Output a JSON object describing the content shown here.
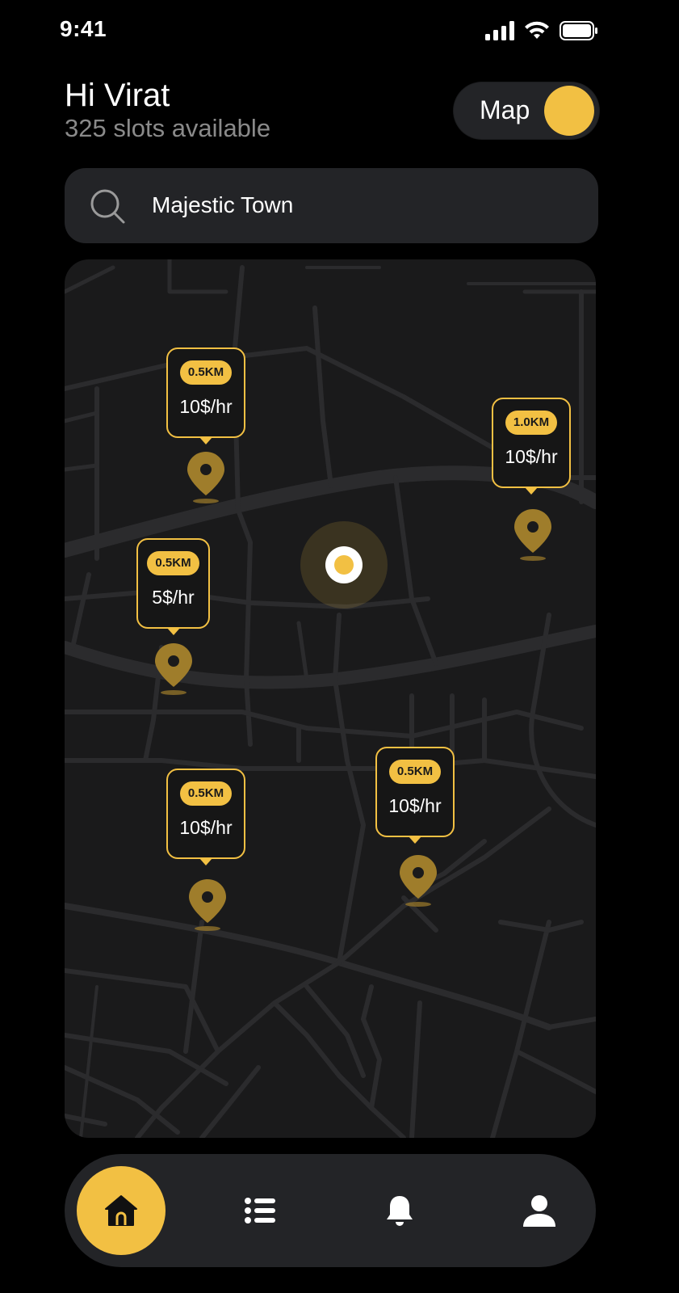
{
  "status_bar": {
    "time": "9:41"
  },
  "header": {
    "greeting": "Hi Virat",
    "subtitle": "325 slots available"
  },
  "map_toggle": {
    "label": "Map",
    "on": true
  },
  "search": {
    "value": "Majestic Town"
  },
  "colors": {
    "accent": "#f2c043",
    "surface": "#232427",
    "background": "#000000",
    "map_bg": "#1a1a1b",
    "road": "#2b2b2d"
  },
  "parking_spots": [
    {
      "distance": "0.5KM",
      "price": "10$/hr"
    },
    {
      "distance": "1.0KM",
      "price": "10$/hr"
    },
    {
      "distance": "0.5KM",
      "price": "5$/hr"
    },
    {
      "distance": "0.5KM",
      "price": "10$/hr"
    },
    {
      "distance": "0.5KM",
      "price": "10$/hr"
    }
  ],
  "nav": {
    "items": [
      {
        "icon": "home-icon",
        "active": true
      },
      {
        "icon": "list-icon",
        "active": false
      },
      {
        "icon": "bell-icon",
        "active": false
      },
      {
        "icon": "user-icon",
        "active": false
      }
    ]
  }
}
